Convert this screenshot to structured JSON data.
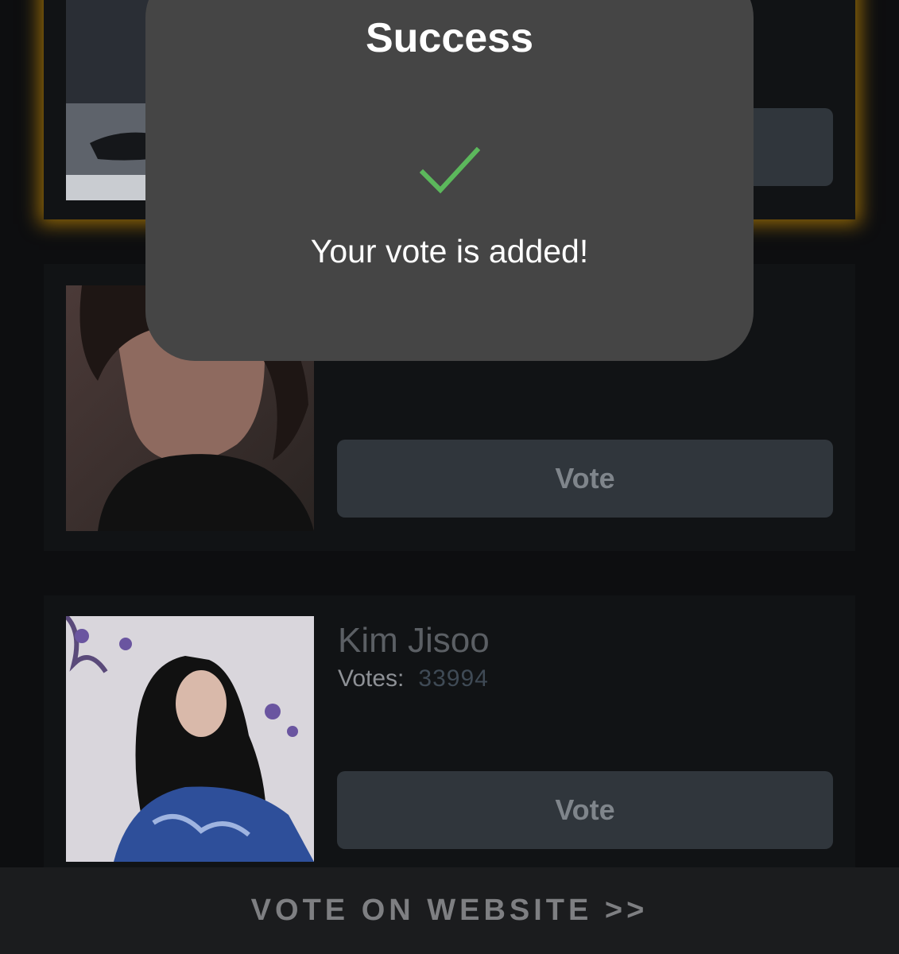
{
  "modal": {
    "title": "Success",
    "message": "Your vote is added!",
    "icon": "checkmark-icon",
    "check_color": "#5cb85c"
  },
  "candidates": [
    {
      "vote_label": ""
    },
    {
      "vote_label": "Vote"
    },
    {
      "name": "Kim Jisoo",
      "votes_label": "Votes:",
      "votes": "33994",
      "vote_label": "Vote"
    }
  ],
  "footer": {
    "label": "VOTE ON WEBSITE >>"
  },
  "colors": {
    "highlight": "#ffb000",
    "button_bg": "#30363c",
    "modal_bg": "#454545"
  }
}
